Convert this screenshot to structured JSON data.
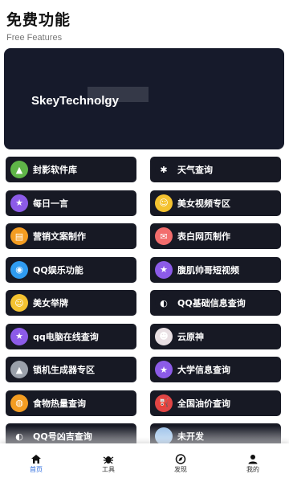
{
  "header": {
    "title": "免费功能",
    "subtitle": "Free Features"
  },
  "banner": {
    "text": "SkeyTechnolgy"
  },
  "features": [
    {
      "label": "封影软件库",
      "icon": "android-icon",
      "icon_color": "#5fb548"
    },
    {
      "label": "天气查询",
      "icon": "snowflake-icon",
      "icon_color": "#171924"
    },
    {
      "label": "每日一言",
      "icon": "star-icon",
      "icon_color": "#8c5be8"
    },
    {
      "label": "美女视频专区",
      "icon": "emoji-icon",
      "icon_color": "#f4c230"
    },
    {
      "label": "营销文案制作",
      "icon": "document-icon",
      "icon_color": "#f39c21"
    },
    {
      "label": "表白网页制作",
      "icon": "love-letter-icon",
      "icon_color": "#f26d6d"
    },
    {
      "label": "QQ娱乐功能",
      "icon": "qq-icon",
      "icon_color": "#2f9bf0"
    },
    {
      "label": "腹肌帅哥短视频",
      "icon": "star-icon",
      "icon_color": "#8c5be8"
    },
    {
      "label": "美女举牌",
      "icon": "emoji-icon",
      "icon_color": "#f4c230"
    },
    {
      "label": "QQ基础信息查询",
      "icon": "qq-penguin-icon",
      "icon_color": "#171924"
    },
    {
      "label": "qq电脑在线查询",
      "icon": "star-icon",
      "icon_color": "#8c5be8"
    },
    {
      "label": "云原神",
      "icon": "anime-avatar-icon",
      "icon_color": "#e8dfe3"
    },
    {
      "label": "锁机生成器专区",
      "icon": "android-gray-icon",
      "icon_color": "#9aa0aa"
    },
    {
      "label": "大学信息查询",
      "icon": "star-icon",
      "icon_color": "#8c5be8"
    },
    {
      "label": "食物热量查询",
      "icon": "food-icon",
      "icon_color": "#f39c21"
    },
    {
      "label": "全国油价查询",
      "icon": "fuel-icon",
      "icon_color": "#e04545"
    },
    {
      "label": "QQ号凶吉查询",
      "icon": "qq-black-icon",
      "icon_color": "#171924"
    },
    {
      "label": "未开发",
      "icon": "blank-icon",
      "icon_color": "#9ec3ea"
    }
  ],
  "tabs": [
    {
      "label": "首页",
      "icon": "home-icon",
      "active": true
    },
    {
      "label": "工具",
      "icon": "bug-icon",
      "active": false
    },
    {
      "label": "发现",
      "icon": "compass-icon",
      "active": false
    },
    {
      "label": "我的",
      "icon": "user-icon",
      "active": false
    }
  ],
  "colors": {
    "card_bg": "#171924",
    "accent": "#2d6cdf"
  }
}
